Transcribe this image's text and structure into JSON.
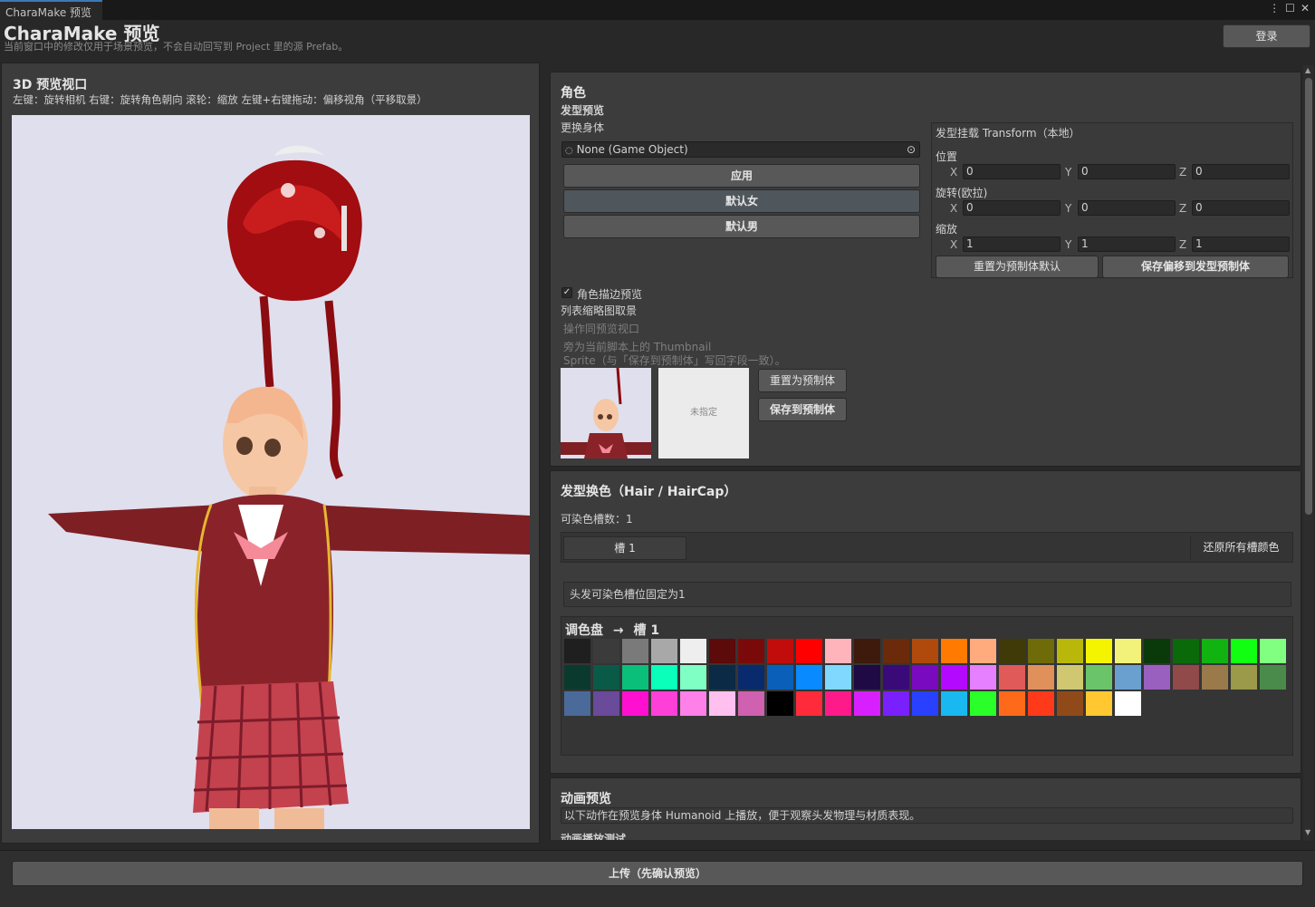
{
  "window": {
    "tab": "CharaMake 预览",
    "title": "CharaMake 预览",
    "subtitle": "当前窗口中的修改仅用于场景预览，不会自动回写到 Project 里的源 Prefab。",
    "login": "登录",
    "upload": "上传（先确认预览）"
  },
  "viewport": {
    "title": "3D 预览视口",
    "hint": "左键：旋转相机    右键：旋转角色朝向    滚轮：缩放    左键+右键拖动：偏移视角（平移取景）"
  },
  "character": {
    "title": "角色",
    "subtitle": "发型预览",
    "body_label": "更换身体",
    "body_field": "None (Game Object)",
    "btn_apply": "应用",
    "btn_default_female": "默认女",
    "btn_default_male": "默认男",
    "outline_label": "角色描边预览",
    "thumb_label": "列表缩略图取景",
    "thumb_hint1": "操作同预览视口",
    "thumb_hint2": "旁为当前脚本上的 Thumbnail",
    "thumb_hint3": "Sprite（与「保存到预制体」写回字段一致）。",
    "thumb_unassigned": "未指定",
    "btn_reset_prefab": "重置为预制体",
    "btn_save_prefab": "保存到预制体"
  },
  "transform": {
    "title": "发型挂载 Transform（本地）",
    "position_label": "位置",
    "rotation_label": "旋转(欧拉)",
    "scale_label": "缩放",
    "axis_x": "X",
    "axis_y": "Y",
    "axis_z": "Z",
    "position": [
      "0",
      "0",
      "0"
    ],
    "rotation": [
      "0",
      "0",
      "0"
    ],
    "scale": [
      "1",
      "1",
      "1"
    ],
    "btn_reset_default": "重置为预制体默认",
    "btn_save_offset": "保存偏移到发型预制体"
  },
  "hair_color": {
    "title": "发型换色（Hair / HairCap）",
    "count_label": "可染色槽数：1",
    "slot_tab": "槽 1",
    "btn_restore": "还原所有槽颜色",
    "fixed_note": "头发可染色槽位固定为1",
    "palette_title": "调色盘",
    "palette_arrow": "→",
    "palette_slot": "槽 1",
    "palette": [
      "#1f1f1f",
      "#3b3b3b",
      "#7a7a7a",
      "#a8a8a8",
      "#eeeeee",
      "#5c0a0a",
      "#7a0a0a",
      "#c20c0c",
      "#ff0000",
      "#ffb3ba",
      "#3e1a0c",
      "#6b2a0a",
      "#b04a0c",
      "#ff7a00",
      "#ffab7e",
      "#3f3a08",
      "#6e6b08",
      "#b9b80a",
      "#f4f400",
      "#f2f27a",
      "#0a3a0a",
      "#0a6a0a",
      "#11b311",
      "#11ff11",
      "#80ff80",
      "#0a3a2e",
      "#0a5a48",
      "#0abf7a",
      "#0affba",
      "#80ffc4",
      "#0a2a46",
      "#0a2a6e",
      "#0a60b8",
      "#0a8aff",
      "#80d8ff",
      "#1f0a46",
      "#3a0a78",
      "#7a0abf",
      "#b30aff",
      "#e680ff",
      "#e05a5a",
      "#e0905a",
      "#d0c870",
      "#6ac46a",
      "#6aa0d0",
      "#9a60c0",
      "#904a4a",
      "#9a7a4a",
      "#9a9a4a",
      "#4a8a4a",
      "#4a6a9a",
      "#6a4a9a",
      "#ff10d0",
      "#ff40d8",
      "#ff80e8",
      "#ffc0f0",
      "#d060b0",
      "#000000",
      "#ff2a3a",
      "#ff1a8a",
      "#d820ff",
      "#7a20ff",
      "#2a40ff",
      "#1ab8f0",
      "#2aff2a",
      "#ff6a1a",
      "#ff3a1a",
      "#904a1a",
      "#ffc830",
      "#ffffff"
    ]
  },
  "animation": {
    "title": "动画预览",
    "desc": "以下动作在预览身体 Humanoid 上播放，便于观察头发物理与材质表现。",
    "test_label": "动画播放测试"
  }
}
